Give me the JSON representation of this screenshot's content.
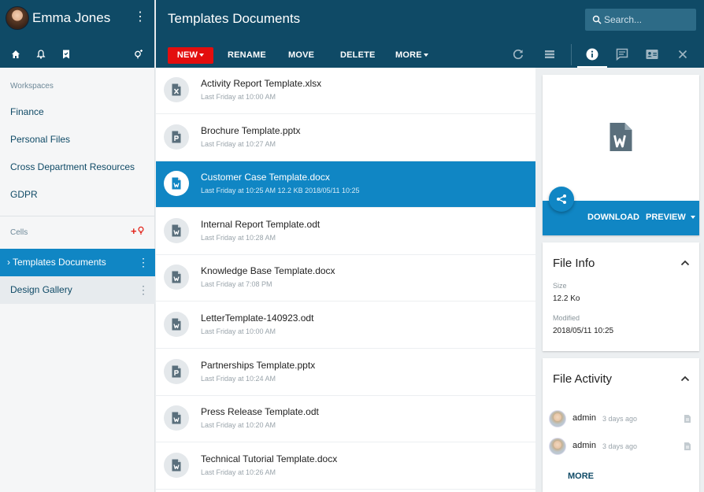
{
  "user": {
    "name": "Emma Jones"
  },
  "header": {
    "title": "Templates Documents"
  },
  "search": {
    "placeholder": "Search..."
  },
  "toolbar": {
    "new_label": "NEW",
    "rename_label": "RENAME",
    "move_label": "MOVE",
    "delete_label": "DELETE",
    "more_label": "MORE"
  },
  "sidebar": {
    "workspaces_label": "Workspaces",
    "workspaces": [
      "Finance",
      "Personal Files",
      "Cross Department Resources",
      "GDPR"
    ],
    "cells_label": "Cells",
    "add_cell_glyph": "+",
    "cells": [
      "Templates Documents",
      "Design Gallery"
    ],
    "active_marker": "›"
  },
  "files": [
    {
      "name": "Activity Report Template.xlsx",
      "meta": "Last Friday at 10:00 AM",
      "type": "xlsx"
    },
    {
      "name": "Brochure Template.pptx",
      "meta": "Last Friday at 10:27 AM",
      "type": "pptx"
    },
    {
      "name": "Customer Case Template.docx",
      "meta": "Last Friday at 10:25 AM   12.2 KB   2018/05/11 10:25",
      "type": "docx",
      "selected": true
    },
    {
      "name": "Internal Report Template.odt",
      "meta": "Last Friday at 10:28 AM",
      "type": "odt"
    },
    {
      "name": "Knowledge Base Template.docx",
      "meta": "Last Friday at 7:08 PM",
      "type": "docx"
    },
    {
      "name": "LetterTemplate-140923.odt",
      "meta": "Last Friday at 10:00 AM",
      "type": "odt"
    },
    {
      "name": "Partnerships Template.pptx",
      "meta": "Last Friday at 10:24 AM",
      "type": "pptx"
    },
    {
      "name": "Press Release Template.odt",
      "meta": "Last Friday at 10:20 AM",
      "type": "odt"
    },
    {
      "name": "Technical Tutorial Template.docx",
      "meta": "Last Friday at 10:26 AM",
      "type": "docx"
    }
  ],
  "preview": {
    "download_label": "DOWNLOAD",
    "preview_label": "PREVIEW"
  },
  "file_info": {
    "title": "File Info",
    "size_label": "Size",
    "size_value": "12.2 Ko",
    "modified_label": "Modified",
    "modified_value": "2018/05/11 10:25"
  },
  "activity": {
    "title": "File Activity",
    "items": [
      {
        "user": "admin",
        "time": "3 days ago"
      },
      {
        "user": "admin",
        "time": "3 days ago"
      }
    ],
    "more_label": "MORE"
  },
  "colors": {
    "primary_dark": "#0f4a66",
    "accent_blue": "#1086c4",
    "new_red": "#e30e0e"
  }
}
